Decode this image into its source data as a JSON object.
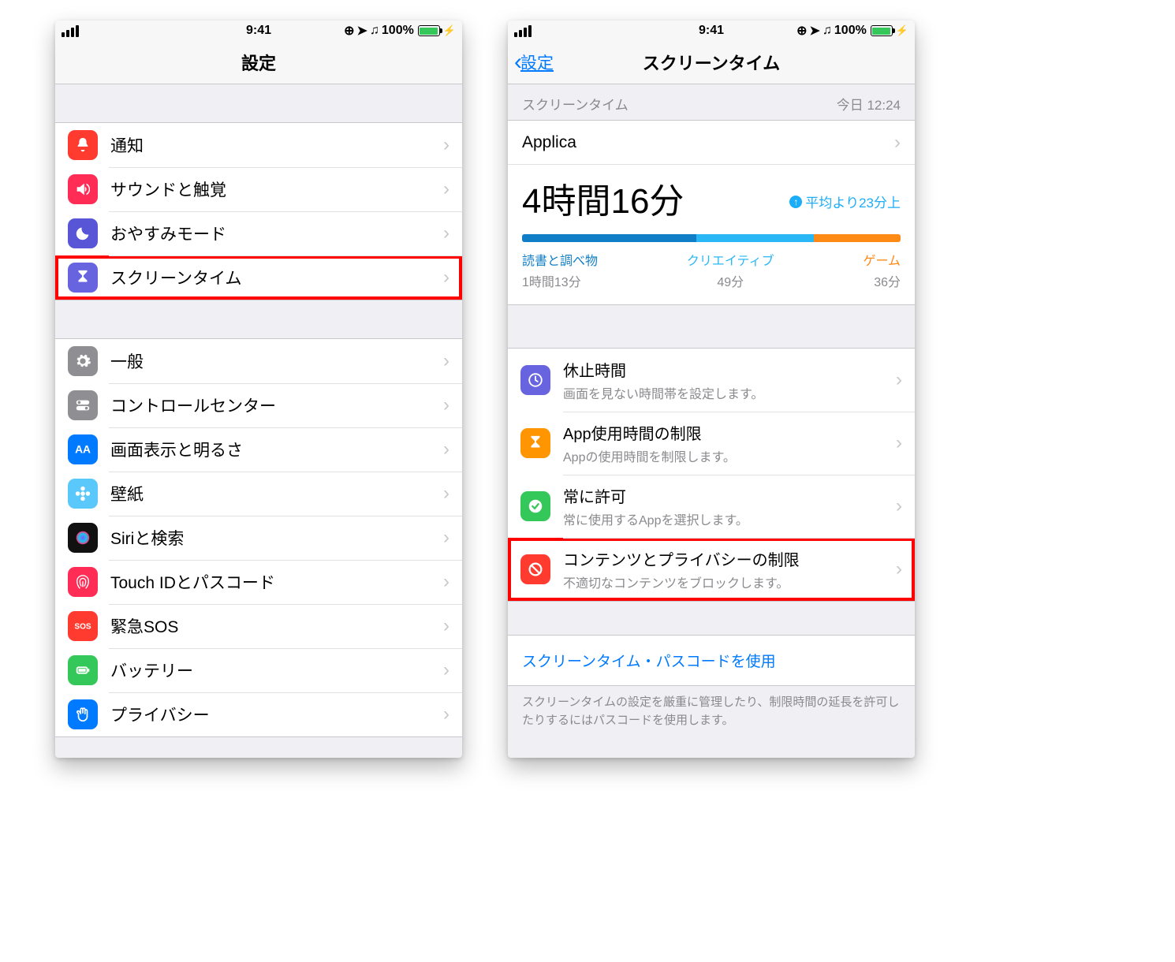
{
  "status": {
    "time": "9:41",
    "battery": "100%"
  },
  "left": {
    "title": "設定",
    "group1": [
      {
        "label": "通知",
        "icon": "bell",
        "color": "ic-red"
      },
      {
        "label": "サウンドと触覚",
        "icon": "speaker",
        "color": "ic-pink"
      },
      {
        "label": "おやすみモード",
        "icon": "moon",
        "color": "ic-purple"
      },
      {
        "label": "スクリーンタイム",
        "icon": "hourglass",
        "color": "ic-indigo",
        "hl": true
      }
    ],
    "group2": [
      {
        "label": "一般",
        "icon": "gear",
        "color": "ic-grey"
      },
      {
        "label": "コントロールセンター",
        "icon": "switches",
        "color": "ic-grey"
      },
      {
        "label": "画面表示と明るさ",
        "icon": "aa",
        "color": "ic-blue"
      },
      {
        "label": "壁紙",
        "icon": "flower",
        "color": "ic-cyan"
      },
      {
        "label": "Siriと検索",
        "icon": "siri",
        "color": "ic-black"
      },
      {
        "label": "Touch IDとパスコード",
        "icon": "finger",
        "color": "ic-touch"
      },
      {
        "label": "緊急SOS",
        "icon": "sos",
        "color": "ic-red"
      },
      {
        "label": "バッテリー",
        "icon": "batt",
        "color": "ic-green"
      },
      {
        "label": "プライバシー",
        "icon": "hand",
        "color": "ic-blue"
      }
    ]
  },
  "right": {
    "back": "設定",
    "title": "スクリーンタイム",
    "header_label": "スクリーンタイム",
    "header_time": "今日 12:24",
    "app_name": "Applica",
    "total_time": "4時間16分",
    "compare": "平均より23分上",
    "bar": [
      46,
      31,
      23
    ],
    "cats": [
      {
        "name": "読書と調べ物",
        "time": "1時間13分",
        "cls": "c1"
      },
      {
        "name": "クリエイティブ",
        "time": "49分",
        "cls": "c2"
      },
      {
        "name": "ゲーム",
        "time": "36分",
        "cls": "c3"
      }
    ],
    "opts": [
      {
        "title": "休止時間",
        "sub": "画面を見ない時間帯を設定します。",
        "icon": "clock",
        "color": "ic-pviolet"
      },
      {
        "title": "App使用時間の制限",
        "sub": "Appの使用時間を制限します。",
        "icon": "hourglass",
        "color": "ic-orange"
      },
      {
        "title": "常に許可",
        "sub": "常に使用するAppを選択します。",
        "icon": "check",
        "color": "ic-green"
      },
      {
        "title": "コンテンツとプライバシーの制限",
        "sub": "不適切なコンテンツをブロックします。",
        "icon": "nosign",
        "color": "ic-red",
        "hl": true
      }
    ],
    "passcode_link": "スクリーンタイム・パスコードを使用",
    "footer": "スクリーンタイムの設定を厳重に管理したり、制限時間の延長を許可したりするにはパスコードを使用します。"
  }
}
